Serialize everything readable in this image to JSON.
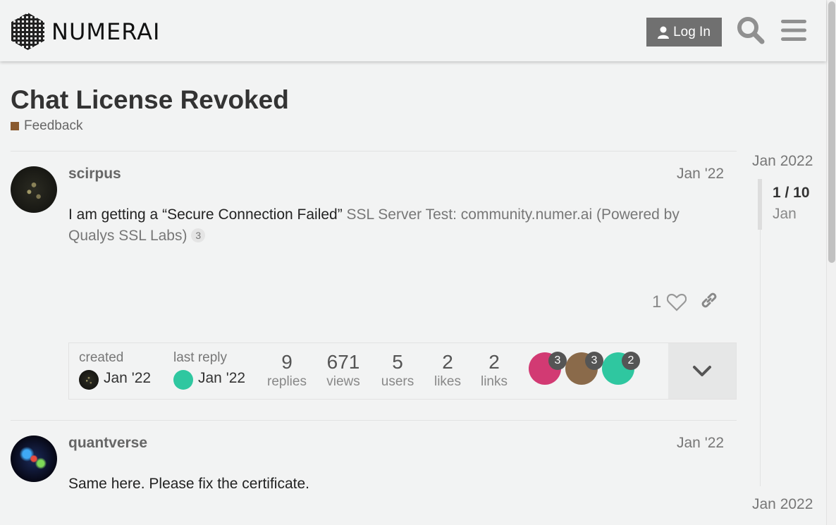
{
  "header": {
    "logo_text": "NUMERAI",
    "login_label": "Log In",
    "search_icon": "search-icon",
    "menu_icon": "hamburger-icon"
  },
  "topic": {
    "title": "Chat License Revoked",
    "category": "Feedback",
    "category_color": "#8a5a2f"
  },
  "posts": [
    {
      "username": "scirpus",
      "date": "Jan '22",
      "body_text": "I am getting a “Secure Connection Failed” ",
      "onebox_text": "SSL Server Test: community.numer.ai (Powered by Qualys SSL Labs)",
      "link_clicks": "3",
      "likes": "1"
    },
    {
      "username": "quantverse",
      "date": "Jan '22",
      "body_text": "Same here. Please fix the certificate."
    }
  ],
  "topic_map": {
    "created_label": "created",
    "created_date": "Jan '22",
    "last_reply_label": "last reply",
    "last_reply_date": "Jan '22",
    "stats": [
      {
        "num": "9",
        "label": "replies"
      },
      {
        "num": "671",
        "label": "views"
      },
      {
        "num": "5",
        "label": "users"
      },
      {
        "num": "2",
        "label": "likes"
      },
      {
        "num": "2",
        "label": "links"
      }
    ],
    "participants": [
      {
        "count": "3",
        "color": "#d23a73"
      },
      {
        "count": "3",
        "color": "#8a6a4a"
      },
      {
        "count": "2",
        "color": "#2fc7a0"
      }
    ]
  },
  "timeline": {
    "start_date": "Jan 2022",
    "position": "1 / 10",
    "position_sub": "Jan",
    "end_date": "Jan 2022"
  }
}
